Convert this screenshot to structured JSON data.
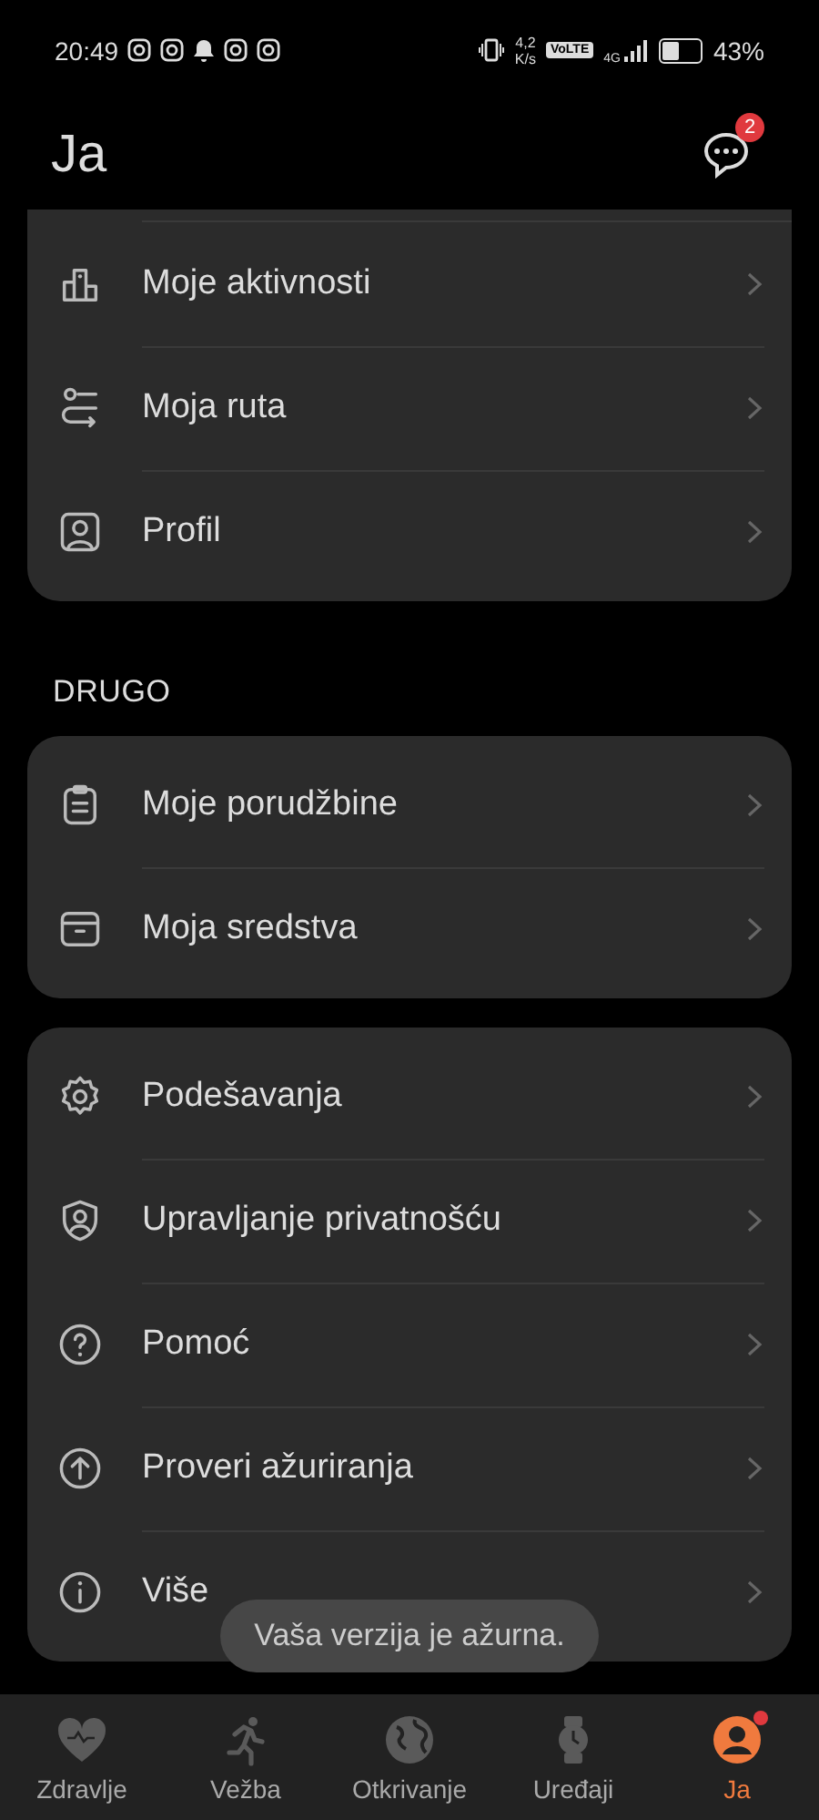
{
  "status_bar": {
    "time": "20:49",
    "speed": "4,2",
    "speed_unit": "K/s",
    "volte": "VoLTE",
    "network": "4G",
    "battery": "43%"
  },
  "header": {
    "title": "Ja",
    "messages_badge": "2"
  },
  "sections": [
    {
      "items": [
        {
          "label": "Moje aktivnosti"
        },
        {
          "label": "Moja ruta"
        },
        {
          "label": "Profil"
        }
      ]
    },
    {
      "label": "DRUGO",
      "items": [
        {
          "label": "Moje porudžbine"
        },
        {
          "label": "Moja sredstva"
        }
      ]
    },
    {
      "items": [
        {
          "label": "Podešavanja"
        },
        {
          "label": "Upravljanje privatnošću"
        },
        {
          "label": "Pomoć"
        },
        {
          "label": "Proveri ažuriranja"
        },
        {
          "label": "Više"
        }
      ]
    }
  ],
  "toast": "Vaša verzija je ažurna.",
  "bottom_nav": [
    {
      "label": "Zdravlje",
      "selected": false,
      "dot": false
    },
    {
      "label": "Vežba",
      "selected": false,
      "dot": false
    },
    {
      "label": "Otkrivanje",
      "selected": false,
      "dot": false
    },
    {
      "label": "Uređaji",
      "selected": false,
      "dot": false
    },
    {
      "label": "Ja",
      "selected": true,
      "dot": true
    }
  ]
}
